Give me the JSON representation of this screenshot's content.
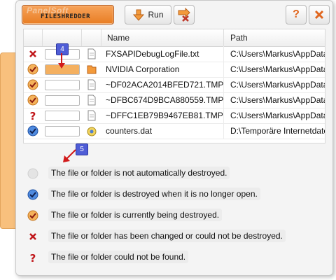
{
  "app": {
    "brand": "PanelSoft",
    "product": "FILESHREDDER"
  },
  "toolbar": {
    "run_label": "Run"
  },
  "table": {
    "columns": [
      "Name",
      "Path"
    ],
    "rows": [
      {
        "status": "error",
        "progress": 0,
        "file_type": "document",
        "name": "FXSAPIDebugLogFile.txt",
        "path": "C:\\Users\\Markus\\AppData"
      },
      {
        "status": "in-progress",
        "progress": 1.0,
        "file_type": "folder",
        "name": "NVIDIA Corporation",
        "path": "C:\\Users\\Markus\\AppData"
      },
      {
        "status": "in-progress",
        "progress": 0,
        "file_type": "document",
        "name": "~DF02ACA2014BFED721.TMP",
        "path": "C:\\Users\\Markus\\AppData"
      },
      {
        "status": "in-progress",
        "progress": 0,
        "file_type": "document",
        "name": "~DFBC674D9BCA880559.TMP",
        "path": "C:\\Users\\Markus\\AppData"
      },
      {
        "status": "not-found",
        "progress": 0,
        "file_type": "document",
        "name": "~DFFC1EB79B9467EB81.TMP",
        "path": "C:\\Users\\Markus\\AppData"
      },
      {
        "status": "on-close",
        "progress": 0,
        "file_type": "system-file",
        "name": "counters.dat",
        "path": "D:\\Temporäre Internetdate"
      }
    ]
  },
  "callouts": {
    "first": "4",
    "second": "5"
  },
  "legend": [
    {
      "status": "none",
      "text": "The file or folder is not automatically destroyed."
    },
    {
      "status": "on-close",
      "text": "The file or folder is destroyed when it is no longer open."
    },
    {
      "status": "in-progress",
      "text": "The file or folder is currently being destroyed."
    },
    {
      "status": "error",
      "text": "The file or folder has been changed or could not be destroyed."
    },
    {
      "status": "not-found",
      "text": "The file or folder could not be found."
    }
  ],
  "colors": {
    "accent": "#f4b060",
    "error": "#d11a1a",
    "info": "#2f6fd8",
    "callout": "#4f5dd6"
  }
}
